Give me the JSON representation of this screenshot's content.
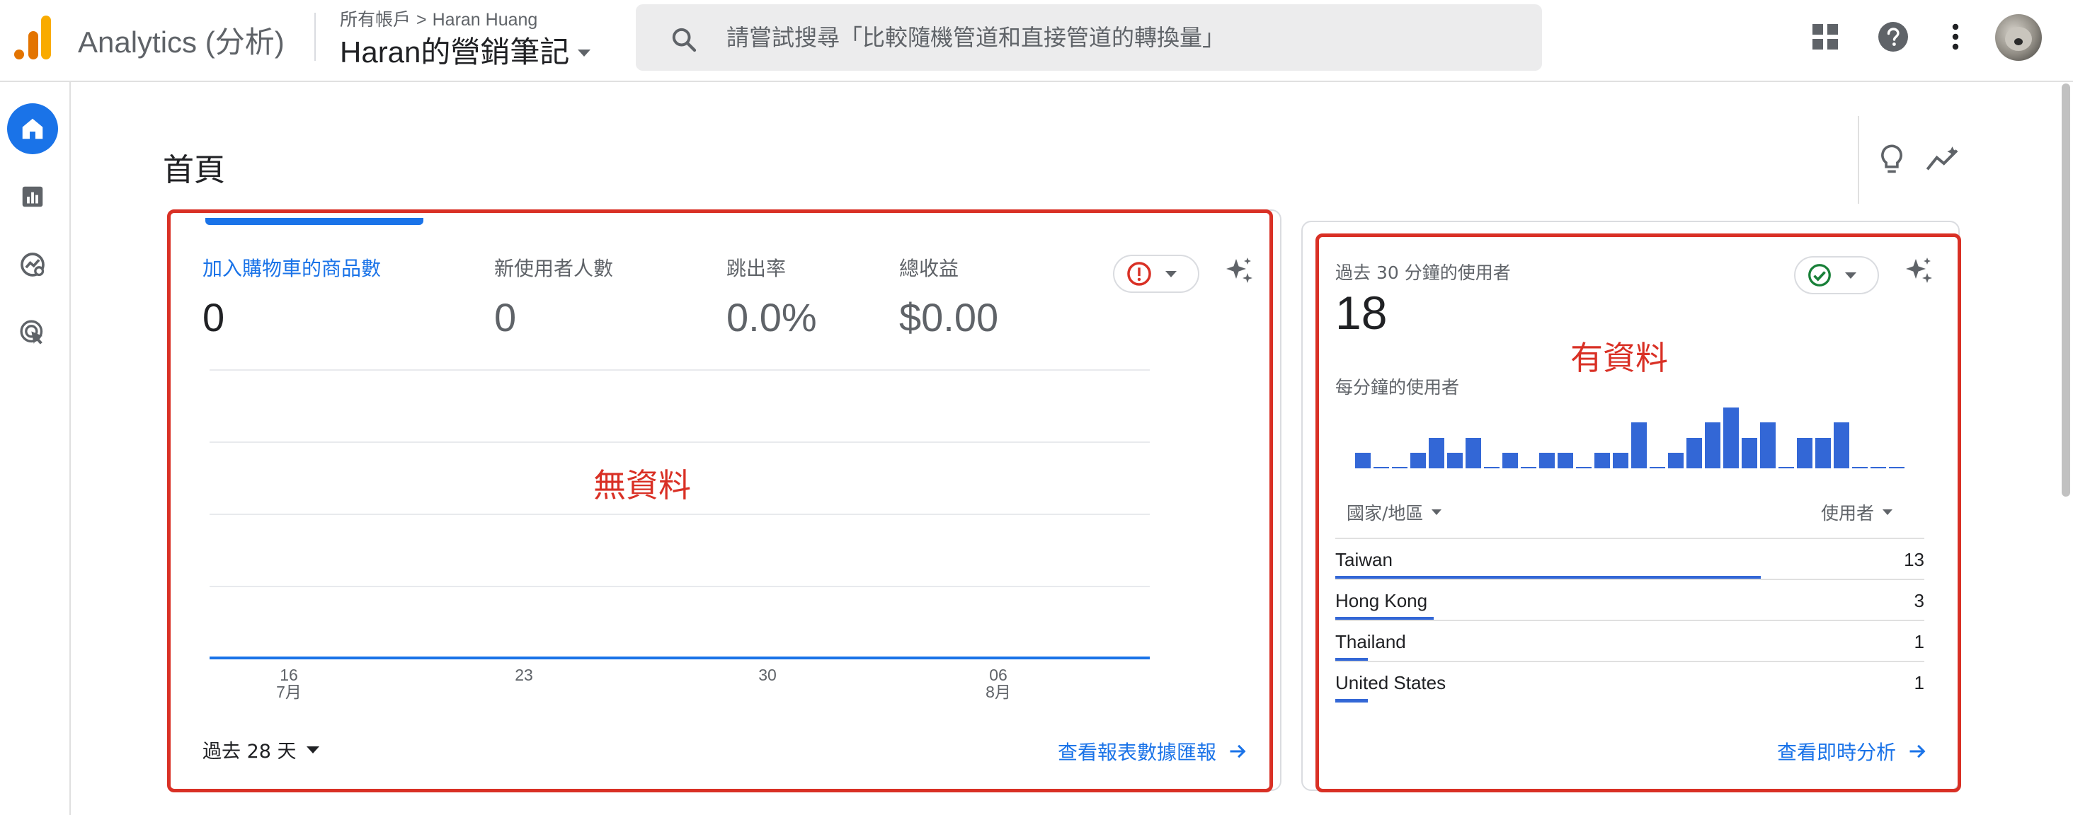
{
  "header": {
    "app_title": "Analytics (分析)",
    "breadcrumb_root": "所有帳戶",
    "breadcrumb_separator": ">",
    "breadcrumb_account": "Haran Huang",
    "property_name": "Haran的營銷筆記",
    "search_placeholder": "請嘗試搜尋「比較隨機管道和直接管道的轉換量」",
    "icons": [
      "apps-grid-icon",
      "help-icon",
      "more-vert-icon",
      "account-avatar"
    ]
  },
  "nav": {
    "items": [
      "home-icon",
      "reports-icon",
      "explore-icon",
      "advertising-icon"
    ],
    "active": "home-icon"
  },
  "page": {
    "title": "首頁",
    "header_icons": [
      "lightbulb-icon",
      "insights-icon"
    ]
  },
  "overview_card": {
    "metrics": [
      {
        "label": "加入購物車的商品數",
        "value": "0",
        "selected": true
      },
      {
        "label": "新使用者人數",
        "value": "0",
        "selected": false
      },
      {
        "label": "跳出率",
        "value": "0.0%",
        "selected": false
      },
      {
        "label": "總收益",
        "value": "$0.00",
        "selected": false
      }
    ],
    "status": "warning",
    "x_ticks": [
      {
        "day": "16",
        "month": "7月"
      },
      {
        "day": "23",
        "month": ""
      },
      {
        "day": "30",
        "month": ""
      },
      {
        "day": "06",
        "month": "8月"
      }
    ],
    "date_range": "過去 28 天",
    "view_link": "查看報表數據匯報",
    "annotation": "無資料"
  },
  "realtime_card": {
    "label": "過去 30 分鐘的使用者",
    "count": "18",
    "sub_label": "每分鐘的使用者",
    "status": "ok",
    "annotation": "有資料",
    "per_minute_users": [
      1,
      0,
      0,
      1,
      2,
      1,
      2,
      0,
      1,
      0,
      1,
      1,
      0,
      1,
      1,
      3,
      0,
      1,
      2,
      3,
      4,
      2,
      3,
      0,
      2,
      2,
      3,
      0,
      0,
      0
    ],
    "dimension_header": "國家/地區",
    "metric_header": "使用者",
    "rows": [
      {
        "country": "Taiwan",
        "users": 13
      },
      {
        "country": "Hong Kong",
        "users": 3
      },
      {
        "country": "Thailand",
        "users": 1
      },
      {
        "country": "United States",
        "users": 1
      }
    ],
    "view_link": "查看即時分析"
  },
  "colors": {
    "accent": "#1a73e8",
    "bar": "#3367d6",
    "annotation_red": "#d93025",
    "ok_green": "#188038",
    "warning_red": "#d93025"
  }
}
